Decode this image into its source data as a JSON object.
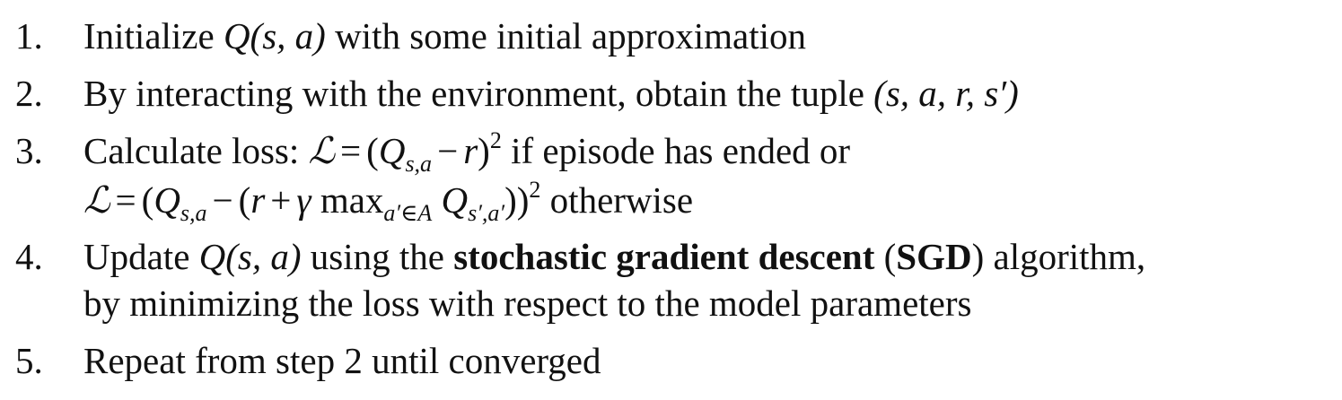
{
  "steps": [
    {
      "number": "1.",
      "pre": "Initialize ",
      "q": "Q(s, a)",
      "post": " with some initial approximation"
    },
    {
      "number": "2.",
      "pre": "By interacting with the environment, obtain the tuple ",
      "tuple": "(s, a, r, s′)"
    },
    {
      "number": "3.",
      "pre": "Calculate loss: ",
      "loss_symbol": "ℒ",
      "eq": "=",
      "open": "(",
      "q": "Q",
      "q_sub": "s,a",
      "minus": "−",
      "r": "r",
      "close": ")",
      "pow": "2",
      "post": " if episode has ended or",
      "cont": {
        "loss_symbol": "ℒ",
        "eq": "=",
        "open": "(",
        "q": "Q",
        "q_sub": "s,a",
        "minus": "−",
        "open2": "(",
        "r": "r",
        "plus": "+",
        "gamma": "γ",
        "max": "max",
        "max_sub": "a′∈A",
        "q2": "Q",
        "q2_sub": "s′,a′",
        "close": "))",
        "pow": "2",
        "post": " otherwise"
      }
    },
    {
      "number": "4.",
      "pre": "Update ",
      "q": "Q(s, a)",
      "mid": " using the ",
      "bold1": "stochastic gradient descent",
      "mid2": " (",
      "bold2": "SGD",
      "post": ") algorithm,",
      "cont": "by minimizing the loss with respect to the model parameters"
    },
    {
      "number": "5.",
      "text": "Repeat from step 2 until converged"
    }
  ]
}
